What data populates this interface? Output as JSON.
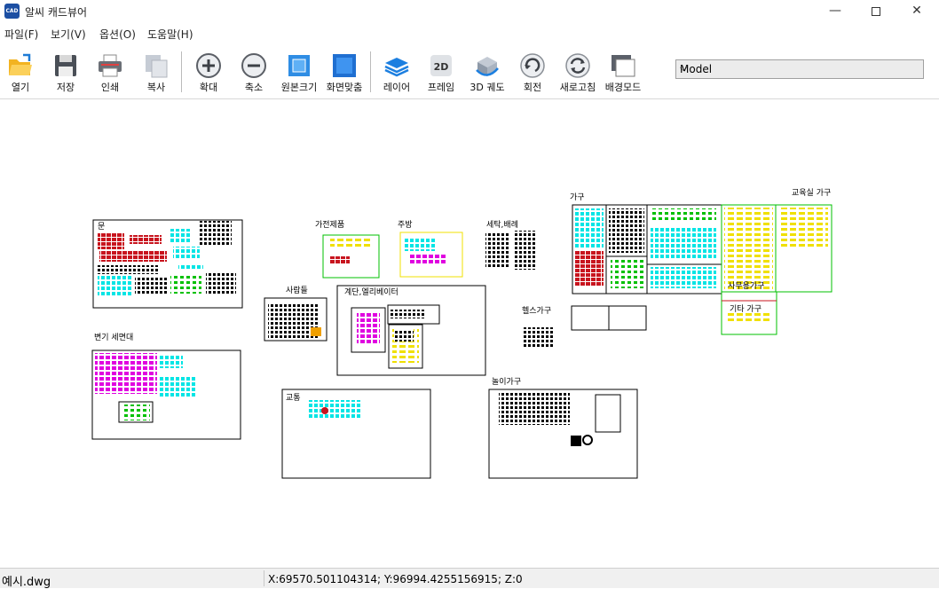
{
  "window": {
    "title": "알씨 캐드뷰어",
    "icon_text": "CAD",
    "controls": [
      "minimize-icon",
      "maximize-icon",
      "close-icon"
    ]
  },
  "menu": [
    {
      "label": "파일(F)"
    },
    {
      "label": "보기(V)"
    },
    {
      "label": "옵션(O)"
    },
    {
      "label": "도움말(H)"
    }
  ],
  "toolbar": {
    "buttons": [
      {
        "label": "열기",
        "icon": "folder-open-icon"
      },
      {
        "label": "저장",
        "icon": "floppy-disk-icon"
      },
      {
        "label": "인쇄",
        "icon": "printer-icon"
      },
      {
        "label": "복사",
        "icon": "copy-icon"
      },
      {
        "label": "확대",
        "icon": "zoom-in-icon"
      },
      {
        "label": "축소",
        "icon": "zoom-out-icon"
      },
      {
        "label": "원본크기",
        "icon": "actual-size-icon"
      },
      {
        "label": "화면맞춤",
        "icon": "fit-screen-icon"
      },
      {
        "label": "레이어",
        "icon": "layers-icon"
      },
      {
        "label": "프레임",
        "icon": "2d-frame-icon"
      },
      {
        "label": "3D 궤도",
        "icon": "3d-orbit-icon"
      },
      {
        "label": "회전",
        "icon": "rotate-icon"
      },
      {
        "label": "새로고침",
        "icon": "refresh-icon"
      },
      {
        "label": "배경모드",
        "icon": "background-mode-icon"
      }
    ],
    "model_select": {
      "value": "Model"
    }
  },
  "drawing": {
    "labels": [
      "문",
      "가전제품",
      "주방",
      "세탁,배례",
      "사람들",
      "계단,엘리베이터",
      "가구",
      "교육실 가구",
      "변기 세면대",
      "헬스가구",
      "교통",
      "놀이가구",
      "사무용가구",
      "기타 가구"
    ],
    "colors": {
      "red": "#c8141e",
      "cyan": "#00e5e5",
      "magenta": "#e000e0",
      "green": "#00c000",
      "yellow": "#f0e000",
      "black": "#000000"
    }
  },
  "status": {
    "file": "예시.dwg",
    "coords": "X:69570.501104314; Y:96994.4255156915; Z:0"
  }
}
